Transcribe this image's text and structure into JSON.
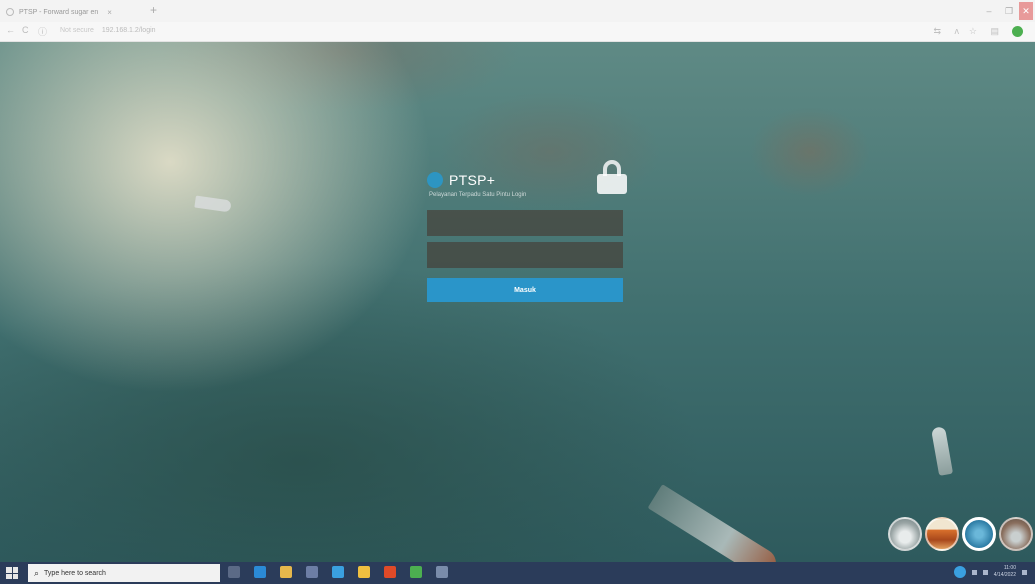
{
  "browser": {
    "tab_title": "PTSP - Forward sugar en",
    "tab_close": "×",
    "new_tab": "+",
    "security_label": "Not secure",
    "url": "192.168.1.2",
    "url_path": "/login",
    "nav_back": "←",
    "nav_reload": "C",
    "nav_info": "ⓘ",
    "win_minimize": "–",
    "win_maximize": "❐",
    "win_close": "✕",
    "ext_icons": [
      "⇆",
      "ʌ",
      "☆",
      "▤"
    ]
  },
  "login": {
    "brand": "PTSP+",
    "subtitle": "Pelayanan Terpadu Satu Pintu Login",
    "username_placeholder": "",
    "password_placeholder": "",
    "submit_label": "Masuk"
  },
  "taskbar": {
    "search_placeholder": "Type here to search",
    "search_icon": "⌕",
    "time": "11:00",
    "date": "4/14/2022",
    "app_icons": [
      {
        "name": "task-view-icon",
        "color": "#5b6a86"
      },
      {
        "name": "edge-icon",
        "color": "#2b8ad6"
      },
      {
        "name": "file-explorer-icon",
        "color": "#e6b84c"
      },
      {
        "name": "store-icon",
        "color": "#6d7ea5"
      },
      {
        "name": "mail-icon",
        "color": "#3aa0e0"
      },
      {
        "name": "photos-icon",
        "color": "#f0c040"
      },
      {
        "name": "office-icon",
        "color": "#e04a28"
      },
      {
        "name": "chrome-icon",
        "color": "#4caf50"
      },
      {
        "name": "app-icon",
        "color": "#7a8caa"
      }
    ]
  },
  "colors": {
    "accent": "#2a95c9",
    "field_bg": "rgba(70,50,40,0.55)",
    "taskbar": "#2b3c5a"
  }
}
